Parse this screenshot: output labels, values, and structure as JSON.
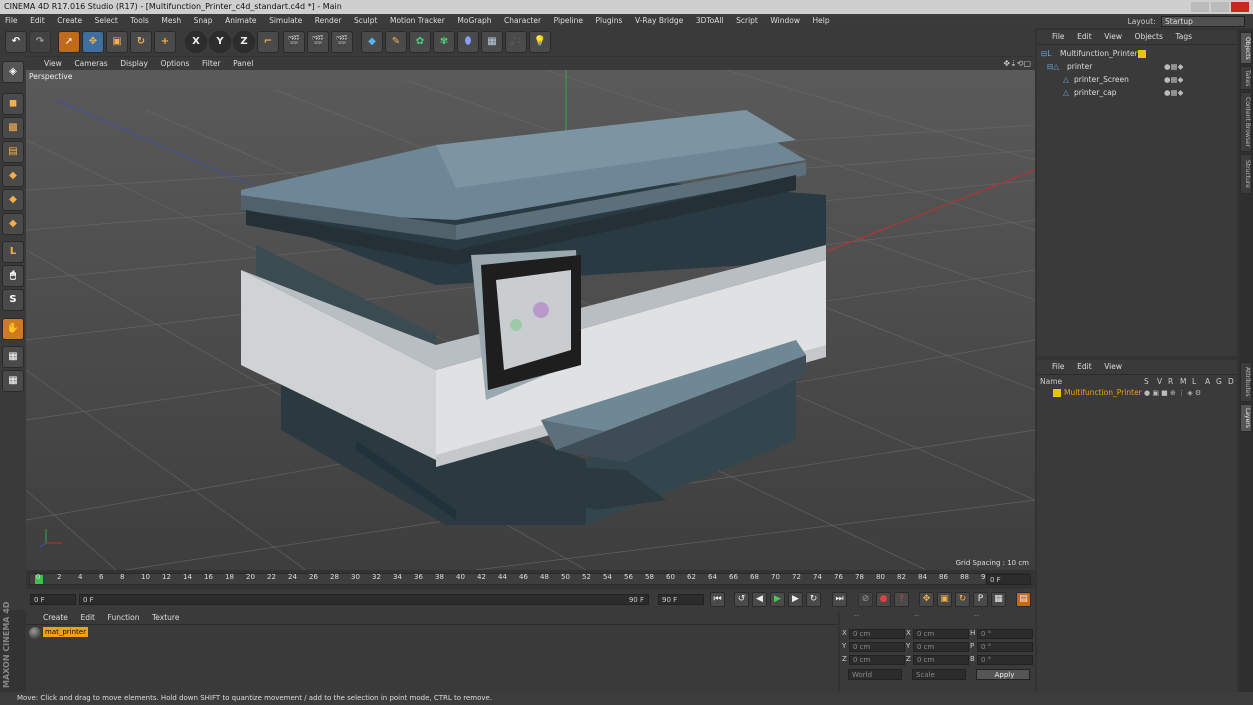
{
  "window": {
    "title": "CINEMA 4D R17.016 Studio (R17) - [Multifunction_Printer_c4d_standart.c4d *] - Main"
  },
  "menubar": {
    "items": [
      "File",
      "Edit",
      "Create",
      "Select",
      "Tools",
      "Mesh",
      "Snap",
      "Animate",
      "Simulate",
      "Render",
      "Sculpt",
      "Motion Tracker",
      "MoGraph",
      "Character",
      "Pipeline",
      "Plugins",
      "V-Ray Bridge",
      "3DToAll",
      "Script",
      "Window",
      "Help"
    ],
    "layout_label": "Layout:",
    "layout_value": "Startup"
  },
  "axis_buttons": [
    "X",
    "Y",
    "Z"
  ],
  "viewport": {
    "menu": [
      "View",
      "Cameras",
      "Display",
      "Options",
      "Filter",
      "Panel"
    ],
    "label": "Perspective",
    "grid_spacing": "Grid Spacing : 10 cm"
  },
  "timeline": {
    "ticks": [
      "0",
      "2",
      "4",
      "6",
      "8",
      "10",
      "12",
      "14",
      "16",
      "18",
      "20",
      "22",
      "24",
      "26",
      "28",
      "30",
      "32",
      "34",
      "36",
      "38",
      "40",
      "42",
      "44",
      "46",
      "48",
      "50",
      "52",
      "54",
      "56",
      "58",
      "60",
      "62",
      "64",
      "66",
      "68",
      "70",
      "72",
      "74",
      "76",
      "78",
      "80",
      "82",
      "84",
      "86",
      "88",
      "90"
    ],
    "current_frame": "0 F"
  },
  "controls": {
    "start": "0 F",
    "current": "0 F",
    "range_end": "90 F",
    "end": "90 F"
  },
  "material_manager": {
    "menu": [
      "Create",
      "Edit",
      "Function",
      "Texture"
    ],
    "material": "mat_printer"
  },
  "attributes": {
    "head": [
      "--",
      "--",
      "--"
    ],
    "rows": [
      {
        "a": "X",
        "av": "0 cm",
        "b": "X",
        "bv": "0 cm",
        "c": "H",
        "cv": "0 °"
      },
      {
        "a": "Y",
        "av": "0 cm",
        "b": "Y",
        "bv": "0 cm",
        "c": "P",
        "cv": "0 °"
      },
      {
        "a": "Z",
        "av": "0 cm",
        "b": "Z",
        "bv": "0 cm",
        "c": "B",
        "cv": "0 °"
      }
    ],
    "world": "World",
    "scale": "Scale",
    "apply": "Apply"
  },
  "objects": {
    "menu": [
      "File",
      "Edit",
      "View",
      "Objects",
      "Tags"
    ],
    "items": [
      "Multifunction_Printer",
      "printer",
      "printer_Screen",
      "printer_cap"
    ]
  },
  "layers": {
    "menu": [
      "File",
      "Edit",
      "View"
    ],
    "cols": [
      "Name",
      "S",
      "V",
      "R",
      "M",
      "L",
      "A",
      "G",
      "D"
    ],
    "item": "Multifunction_Printer"
  },
  "side_tabs": [
    "Objects",
    "Takes",
    "Content Browser",
    "Structure",
    "Attributes",
    "Layers"
  ],
  "brand": "MAXON CINEMA 4D",
  "status": "Move: Click and drag to move elements. Hold down SHIFT to quantize movement / add to the selection in point mode, CTRL to remove.",
  "colors": {
    "accent": "#c06a1a",
    "layer_yellow": "#e6c21a",
    "selection_orange": "#f0a010"
  }
}
